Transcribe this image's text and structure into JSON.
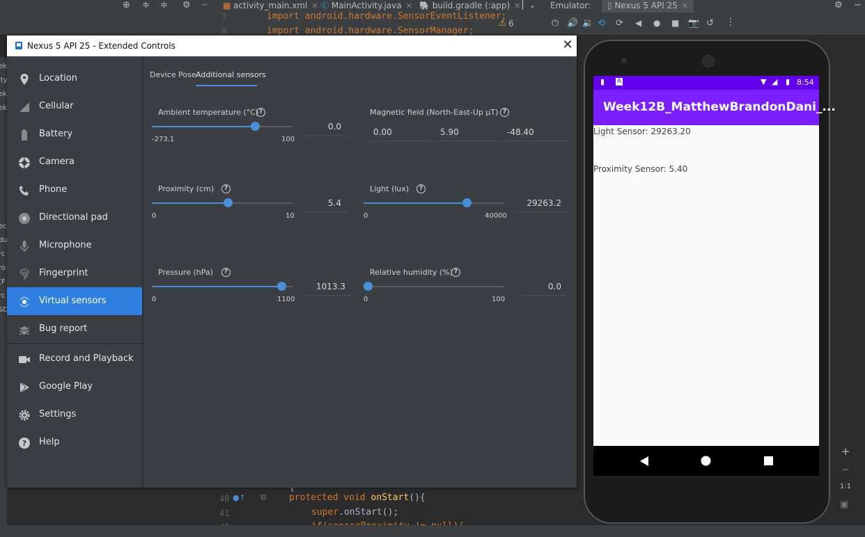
{
  "ide": {
    "tabs": [
      {
        "label": "activity_main.xml"
      },
      {
        "label": "MainActivity.java"
      },
      {
        "label": "build.gradle (:app)"
      }
    ],
    "emulator_label": "Emulator:",
    "emulator_device": "Nexus 5 API 25",
    "warning_count": "6",
    "code_top": {
      "line7": "import android.hardware.SensorEventListener;",
      "line8": "import android.hardware.SensorManager;",
      "ln7": "7",
      "ln8": "8"
    },
    "code_bottom": {
      "ln40": "40",
      "ln41": "41",
      "ln42": "42",
      "brace": "{",
      "kw_protected": "protected",
      "kw_void": "void",
      "method": "onStart",
      "rest40": "(){",
      "kw_super": "super",
      "rest41": ".onStart();",
      "line42": "if(sensorProximity != null){"
    },
    "left_fragments": [
      "ek",
      "ity",
      "ek",
      "ek",
      "ec",
      "du",
      "rc",
      "ro",
      "(F",
      "rc",
      "SD"
    ],
    "rail": {
      "zoom_in": "+",
      "zoom_out": "−",
      "one_to_one": "1:1"
    }
  },
  "window": {
    "title": "Nexus 5 API 25 - Extended Controls",
    "close": "✕"
  },
  "sidebar": {
    "items": [
      {
        "label": "Location",
        "icon": "location-pin-icon"
      },
      {
        "label": "Cellular",
        "icon": "cellular-signal-icon"
      },
      {
        "label": "Battery",
        "icon": "battery-icon"
      },
      {
        "label": "Camera",
        "icon": "camera-aperture-icon"
      },
      {
        "label": "Phone",
        "icon": "phone-icon"
      },
      {
        "label": "Directional pad",
        "icon": "dpad-icon"
      },
      {
        "label": "Microphone",
        "icon": "microphone-icon"
      },
      {
        "label": "Fingerprint",
        "icon": "fingerprint-icon"
      },
      {
        "label": "Virtual sensors",
        "icon": "virtual-sensors-icon",
        "active": true
      },
      {
        "label": "Bug report",
        "icon": "bug-icon"
      },
      {
        "label": "Record and Playback",
        "icon": "video-camera-icon"
      },
      {
        "label": "Google Play",
        "icon": "google-play-icon"
      },
      {
        "label": "Settings",
        "icon": "gear-icon"
      },
      {
        "label": "Help",
        "icon": "help-icon"
      }
    ]
  },
  "tabs": {
    "device_pose": "Device Pose",
    "additional_sensors": "Additional sensors"
  },
  "sensors": {
    "ambient": {
      "label": "Ambient temperature (°C)",
      "min": "-273.1",
      "max": "100",
      "value": "0.0",
      "fraction": 0.732
    },
    "magnetic": {
      "label": "Magnetic field (North-East-Up µT)",
      "x": "0.00",
      "y": "5.90",
      "z": "-48.40"
    },
    "proximity": {
      "label": "Proximity (cm)",
      "min": "0",
      "max": "10",
      "value": "5.4",
      "fraction": 0.54
    },
    "light": {
      "label": "Light (lux)",
      "min": "0",
      "max": "40000",
      "value": "29263.2",
      "fraction": 0.7316
    },
    "pressure": {
      "label": "Pressure (hPa)",
      "min": "0",
      "max": "1100",
      "value": "1013.3",
      "fraction": 0.9212
    },
    "humidity": {
      "label": "Relative humidity (%)",
      "min": "0",
      "max": "100",
      "value": "0.0",
      "fraction": 0.0
    }
  },
  "phone": {
    "status_time": "8:54",
    "app_title": "Week12B_MatthewBrandonDani_...",
    "light_text": "Light Sensor: 29263.20",
    "proximity_text": "Proximity Sensor: 5.40"
  },
  "colors": {
    "accent": "#4a90d9",
    "active_item": "#2f7fe0",
    "app_bar": "#7b1fff",
    "status_bar": "#6200ee"
  }
}
